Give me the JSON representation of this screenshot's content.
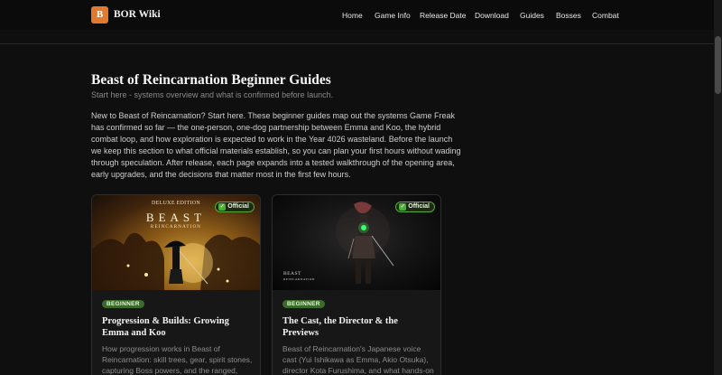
{
  "site": {
    "logo_letter": "B",
    "name": "BOR Wiki"
  },
  "nav": [
    {
      "label": "Home"
    },
    {
      "label": "Game Info"
    },
    {
      "label": "Release Date"
    },
    {
      "label": "Download"
    },
    {
      "label": "Guides"
    },
    {
      "label": "Bosses"
    },
    {
      "label": "Combat"
    }
  ],
  "page": {
    "title": "Beast of Reincarnation Beginner Guides",
    "subtitle": "Start here - systems overview and what is confirmed before launch.",
    "intro": "New to Beast of Reincarnation? Start here. These beginner guides map out the systems Game Freak has confirmed so far — the one-person, one-dog partnership between Emma and Koo, the hybrid combat loop, and how exploration is expected to work in the Year 4026 wasteland. Before the launch we keep this section to what official materials establish, so you can plan your first hours without wading through speculation. After release, each page expands into a tested walkthrough of the opening area, early upgrades, and the decisions that matter most in the first few hours."
  },
  "cards": [
    {
      "badge": "Official",
      "tag": "BEGINNER",
      "title": "Progression & Builds: Growing Emma and Koo",
      "desc": "How progression works in Beast of Reincarnation: skill trees, gear, spirit stones, capturing Boss powers, and the ranged,",
      "art": {
        "edition": "DELUXE EDITION",
        "logo": "BEAST",
        "logo_sub": "REINCARNATION"
      }
    },
    {
      "badge": "Official",
      "tag": "BEGINNER",
      "title": "The Cast, the Director & the Previews",
      "desc": "Beast of Reincarnation's Japanese voice cast (Yui Ishikawa as Emma, Akio Otsuka), director Kota Furushima, and what hands-on previews",
      "art": {
        "logo_line1": "BEAST",
        "logo_line2": "REINCARNATION"
      }
    }
  ]
}
